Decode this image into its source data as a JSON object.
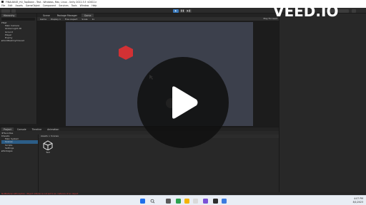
{
  "window": {
    "title": "FINALBASE_HU_TopDown - Test - Windows, Mac, Linux - Unity 2022.3.5 <DX11>"
  },
  "menu": [
    "File",
    "Edit",
    "Assets",
    "GameObject",
    "Component",
    "Services",
    "Tools",
    "Window",
    "Help"
  ],
  "hierarchy": {
    "tab": "Hierarchy",
    "items": [
      {
        "label": "Test"
      },
      {
        "label": "Main Camera"
      },
      {
        "label": "Global Light 2D"
      },
      {
        "label": "Ground"
      },
      {
        "label": "Player"
      },
      {
        "label": "Enemy"
      },
      {
        "label": "DontDestroyOnLoad"
      }
    ]
  },
  "scene": {
    "tabs": [
      "Scene",
      "Package Manager",
      "Game"
    ],
    "game_toolbar": [
      "Game",
      "Display 1",
      "Free Aspect",
      "Scale",
      "1x"
    ],
    "right_tools": "Play Focused"
  },
  "project": {
    "tabs": [
      "Project",
      "Console",
      "Timeline",
      "Animation"
    ],
    "favorites_label": "Favorites",
    "tree": [
      "Assets",
      "Main System",
      "Scenes",
      "Scripts",
      "Settings",
      "Packages"
    ],
    "breadcrumb": "Assets > Scenes",
    "asset_label": "Test"
  },
  "status": {
    "error": "NullReferenceException: Object reference not set to an instance of an object"
  },
  "watermark": "VEED.IO",
  "clock": {
    "time": "4:07 PM",
    "date": "8/1/2023"
  },
  "colors": {
    "hexagon": "#d23134",
    "game_bg": "#3c404c",
    "play_active": "#3a79bb"
  }
}
